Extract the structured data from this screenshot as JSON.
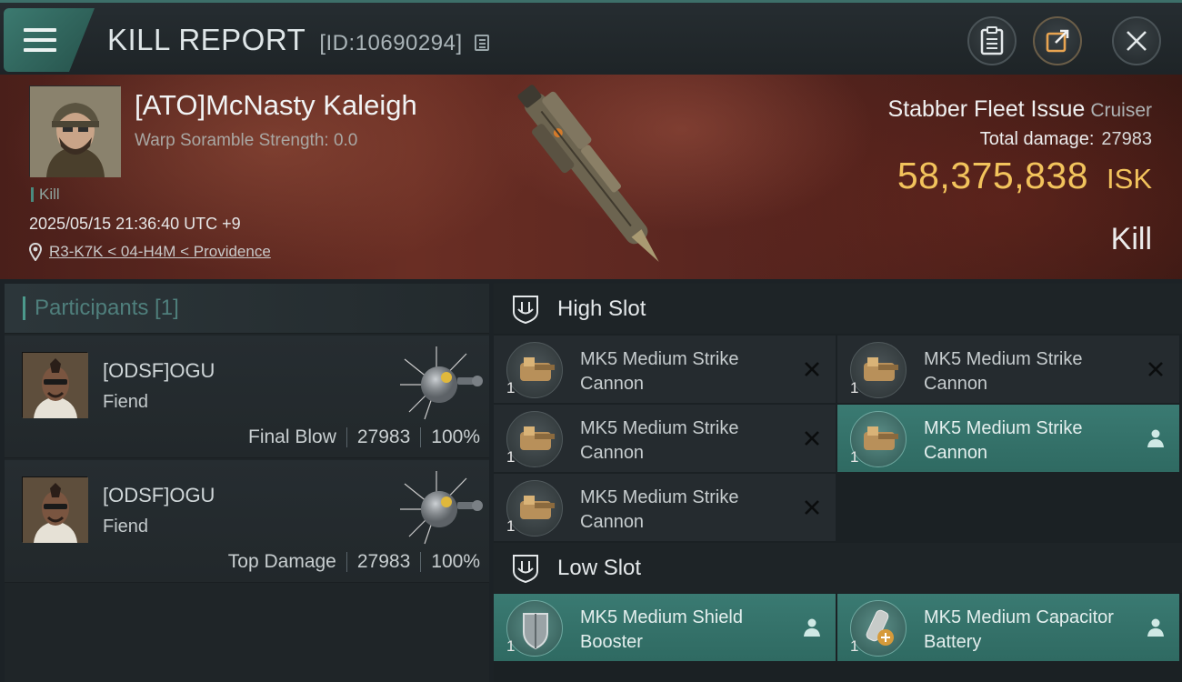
{
  "header": {
    "title": "KILL REPORT",
    "report_id": "[ID:10690294]"
  },
  "victim": {
    "name": "[ATO]McNasty Kaleigh",
    "warp_scramble": "Warp Soramble Strength: 0.0",
    "tag": "Kill",
    "timestamp": "2025/05/15 21:36:40 UTC +9",
    "location": "R3-K7K < 04-H4M < Providence"
  },
  "ship": {
    "name": "Stabber Fleet Issue",
    "class": "Cruiser",
    "total_damage_label": "Total damage:",
    "total_damage": "27983",
    "isk_value": "58,375,838",
    "isk_unit": "ISK",
    "result": "Kill"
  },
  "participants": {
    "header": "Participants [1]",
    "rows": [
      {
        "name": "[ODSF]OGU",
        "ship": "Fiend",
        "role": "Final Blow",
        "damage": "27983",
        "percent": "100%"
      },
      {
        "name": "[ODSF]OGU",
        "ship": "Fiend",
        "role": "Top Damage",
        "damage": "27983",
        "percent": "100%"
      }
    ]
  },
  "slots": {
    "high": {
      "label": "High Slot",
      "items": [
        {
          "name": "MK5 Medium Strike Cannon",
          "qty": "1",
          "status": "destroyed"
        },
        {
          "name": "MK5 Medium Strike Cannon",
          "qty": "1",
          "status": "destroyed"
        },
        {
          "name": "MK5 Medium Strike Cannon",
          "qty": "1",
          "status": "destroyed"
        },
        {
          "name": "MK5 Medium Strike Cannon",
          "qty": "1",
          "status": "dropped"
        },
        {
          "name": "MK5 Medium Strike Cannon",
          "qty": "1",
          "status": "destroyed"
        }
      ]
    },
    "low": {
      "label": "Low Slot",
      "items": [
        {
          "name": "MK5 Medium Shield Booster",
          "qty": "1",
          "status": "dropped"
        },
        {
          "name": "MK5 Medium Capacitor Battery",
          "qty": "1",
          "status": "dropped"
        }
      ]
    }
  },
  "colors": {
    "accent": "#3c7a70",
    "isk": "#f2c35c",
    "dropped_row": "#3a7a72"
  },
  "icons": {
    "menu": "hamburger-icon",
    "copy": "copy-icon",
    "clipboard": "clipboard-icon",
    "share": "share-icon",
    "close": "close-icon",
    "location": "location-pin-icon",
    "destroyed": "x-icon",
    "dropped": "person-icon"
  }
}
